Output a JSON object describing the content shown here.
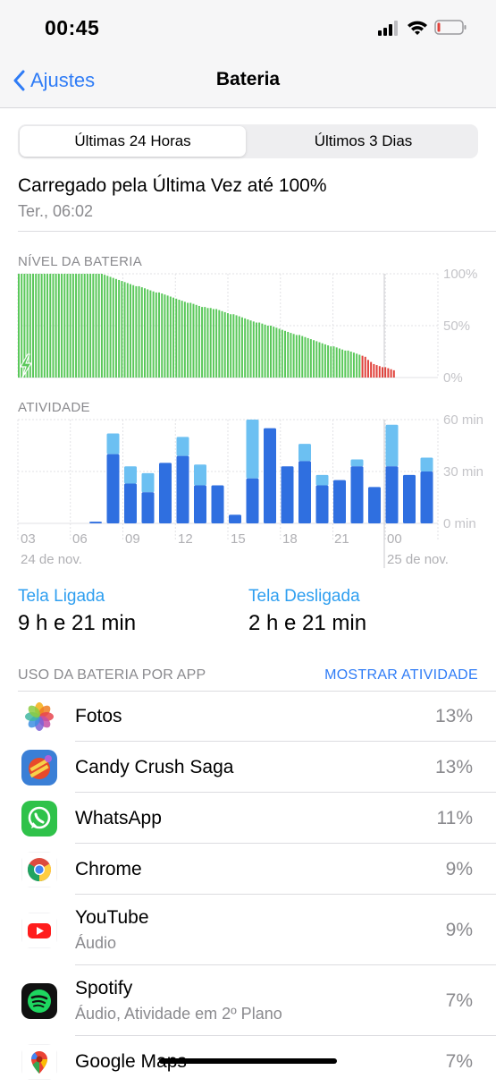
{
  "status_bar": {
    "time": "00:45"
  },
  "nav": {
    "back_label": "Ajustes",
    "title": "Bateria"
  },
  "segments": {
    "active": "Últimas 24 Horas",
    "inactive": "Últimos 3 Dias"
  },
  "last_charge": {
    "title": "Carregado pela Última Vez até 100%",
    "time": "Ter., 06:02"
  },
  "battery_level": {
    "label": "NÍVEL DA BATERIA",
    "y_ticks": [
      "100%",
      "50%",
      "0%"
    ]
  },
  "activity": {
    "label": "ATIVIDADE",
    "y_ticks": [
      "60 min",
      "30 min",
      "0 min"
    ],
    "x_ticks": [
      "03",
      "06",
      "09",
      "12",
      "15",
      "18",
      "21",
      "00"
    ],
    "date_left": "24 de nov.",
    "date_right": "25 de nov."
  },
  "screen": {
    "on_label": "Tela Ligada",
    "on_value": "9 h e 21 min",
    "off_label": "Tela Desligada",
    "off_value": "2 h e 21 min"
  },
  "usage": {
    "header": "USO DA BATERIA POR APP",
    "show_activity": "MOSTRAR ATIVIDADE"
  },
  "apps": [
    {
      "name": "Fotos",
      "sub": "",
      "pct": "13%",
      "icon": "photos-icon"
    },
    {
      "name": "Candy Crush Saga",
      "sub": "",
      "pct": "13%",
      "icon": "candy-crush-icon"
    },
    {
      "name": "WhatsApp",
      "sub": "",
      "pct": "11%",
      "icon": "whatsapp-icon"
    },
    {
      "name": "Chrome",
      "sub": "",
      "pct": "9%",
      "icon": "chrome-icon"
    },
    {
      "name": "YouTube",
      "sub": "Áudio",
      "pct": "9%",
      "icon": "youtube-icon"
    },
    {
      "name": "Spotify",
      "sub": "Áudio, Atividade em 2º Plano",
      "pct": "7%",
      "icon": "spotify-icon"
    },
    {
      "name": "Google Maps",
      "sub": "",
      "pct": "7%",
      "icon": "google-maps-icon"
    }
  ],
  "colors": {
    "accent": "#2f7cf6",
    "battery_green": "#5ac85a",
    "battery_red": "#e0413a",
    "screen_on": "#2f6fe0",
    "screen_off": "#6cc0f2"
  },
  "chart_data": [
    {
      "type": "bar",
      "title": "NÍVEL DA BATERIA",
      "ylim": [
        0,
        100
      ],
      "y_unit": "%",
      "series": [
        {
          "values": [
            100,
            100,
            100,
            100,
            100,
            100,
            100,
            100,
            100,
            100,
            100,
            100,
            100,
            100,
            100,
            100,
            100,
            100,
            100,
            100,
            100,
            100,
            100,
            100,
            100,
            100,
            100,
            100,
            100,
            100,
            99,
            98,
            97,
            96,
            95,
            94,
            93,
            92,
            91,
            90,
            89,
            88,
            88,
            87,
            86,
            85,
            84,
            83,
            82,
            82,
            81,
            80,
            79,
            78,
            77,
            76,
            75,
            74,
            73,
            72,
            72,
            71,
            70,
            69,
            68,
            68,
            67,
            67,
            66,
            66,
            65,
            64,
            63,
            62,
            61,
            61,
            60,
            59,
            58,
            57,
            56,
            55,
            54,
            53,
            53,
            52,
            51,
            50,
            50,
            49,
            48,
            47,
            46,
            45,
            44,
            43,
            42,
            41,
            41,
            40,
            39,
            38,
            37,
            36,
            35,
            34,
            33,
            32,
            31,
            30,
            30,
            29,
            28,
            27,
            26,
            26,
            25,
            24,
            23,
            22,
            21,
            20,
            17,
            15,
            13,
            12,
            11,
            10,
            10,
            9,
            8,
            7
          ]
        }
      ],
      "charging_until_index": 30,
      "low_from_index": 120
    },
    {
      "type": "bar",
      "title": "ATIVIDADE",
      "ylim": [
        0,
        60
      ],
      "y_unit": "min",
      "categories": [
        "03",
        "04",
        "05",
        "06",
        "07",
        "08",
        "09",
        "10",
        "11",
        "12",
        "13",
        "14",
        "15",
        "16",
        "17",
        "18",
        "19",
        "20",
        "21",
        "22",
        "23",
        "00",
        "01"
      ],
      "series": [
        {
          "name": "Tela Ligada",
          "values": [
            0,
            0,
            1,
            40,
            23,
            18,
            35,
            39,
            22,
            22,
            5,
            26,
            55,
            33,
            36,
            22,
            25,
            33,
            21,
            33,
            28,
            30,
            0
          ]
        },
        {
          "name": "Tela Desligada",
          "values": [
            0,
            0,
            0,
            12,
            10,
            11,
            0,
            11,
            12,
            0,
            0,
            34,
            0,
            0,
            10,
            6,
            0,
            4,
            0,
            24,
            0,
            8,
            0
          ]
        }
      ]
    }
  ]
}
